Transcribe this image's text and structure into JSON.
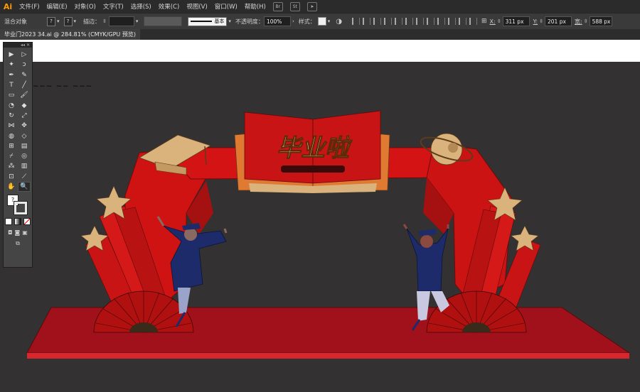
{
  "app": {
    "logo": "Ai"
  },
  "menu": [
    "文件(F)",
    "编辑(E)",
    "对象(O)",
    "文字(T)",
    "选择(S)",
    "效果(C)",
    "视图(V)",
    "窗口(W)",
    "帮助(H)"
  ],
  "menu_icons": [
    "bridge-icon",
    "stock-icon",
    "gpu-rocket-icon"
  ],
  "menu_icon_labels": [
    "Br",
    "St",
    "➤"
  ],
  "controlbar": {
    "selection_label": "混合对象",
    "fill_label": "?",
    "stroke_label": "?",
    "stroke_weight_label": "描边：",
    "stroke_style": "基本",
    "opacity_label": "不透明度：",
    "opacity_value": "100%",
    "style_label": "样式：",
    "x_label": "X:",
    "x_value": "311 px",
    "y_label": "Y:",
    "y_value": "201 px",
    "w_label": "宽:",
    "w_value": "588 px"
  },
  "document": {
    "tab_title": "毕业门2023  34.ai @ 284.81% (CMYK/GPU 预览)"
  },
  "artwork": {
    "banner_text": "毕业啦",
    "colors": {
      "red": "#d41414",
      "dark_red": "#8e0d0d",
      "gold": "#d9b27c",
      "navy": "#1d2b6b",
      "floor": "#a0111b",
      "bg": "#333131"
    }
  },
  "tools": [
    [
      "selection-tool-icon",
      "▶"
    ],
    [
      "direct-selection-tool-icon",
      "▷"
    ],
    [
      "magic-wand-icon",
      "✦"
    ],
    [
      "lasso-icon",
      "ↄ"
    ],
    [
      "pen-tool-icon",
      "✒"
    ],
    [
      "curvature-tool-icon",
      "✎"
    ],
    [
      "type-tool-icon",
      "T"
    ],
    [
      "line-tool-icon",
      "╱"
    ],
    [
      "rectangle-tool-icon",
      "▭"
    ],
    [
      "paintbrush-icon",
      "🖌"
    ],
    [
      "shaper-tool-icon",
      "◔"
    ],
    [
      "eraser-icon",
      "◆"
    ],
    [
      "rotate-tool-icon",
      "↻"
    ],
    [
      "scale-tool-icon",
      "⤢"
    ],
    [
      "width-tool-icon",
      "⋈"
    ],
    [
      "puppet-warp-icon",
      "✥"
    ],
    [
      "shape-builder-icon",
      "◍"
    ],
    [
      "perspective-grid-icon",
      "◇"
    ],
    [
      "mesh-tool-icon",
      "⊞"
    ],
    [
      "gradient-tool-icon",
      "▤"
    ],
    [
      "eyedropper-icon",
      "⌿"
    ],
    [
      "blend-tool-icon",
      "◎"
    ],
    [
      "symbol-sprayer-icon",
      "⁂"
    ],
    [
      "graph-tool-icon",
      "▥"
    ],
    [
      "artboard-tool-icon",
      "⊡"
    ],
    [
      "slice-tool-icon",
      "⟋"
    ],
    [
      "hand-tool-icon",
      "✋"
    ],
    [
      "zoom-tool-icon",
      "🔍"
    ]
  ],
  "toolbox_extras": {
    "fill_glyph": "?",
    "bottom_label": "⋯"
  }
}
